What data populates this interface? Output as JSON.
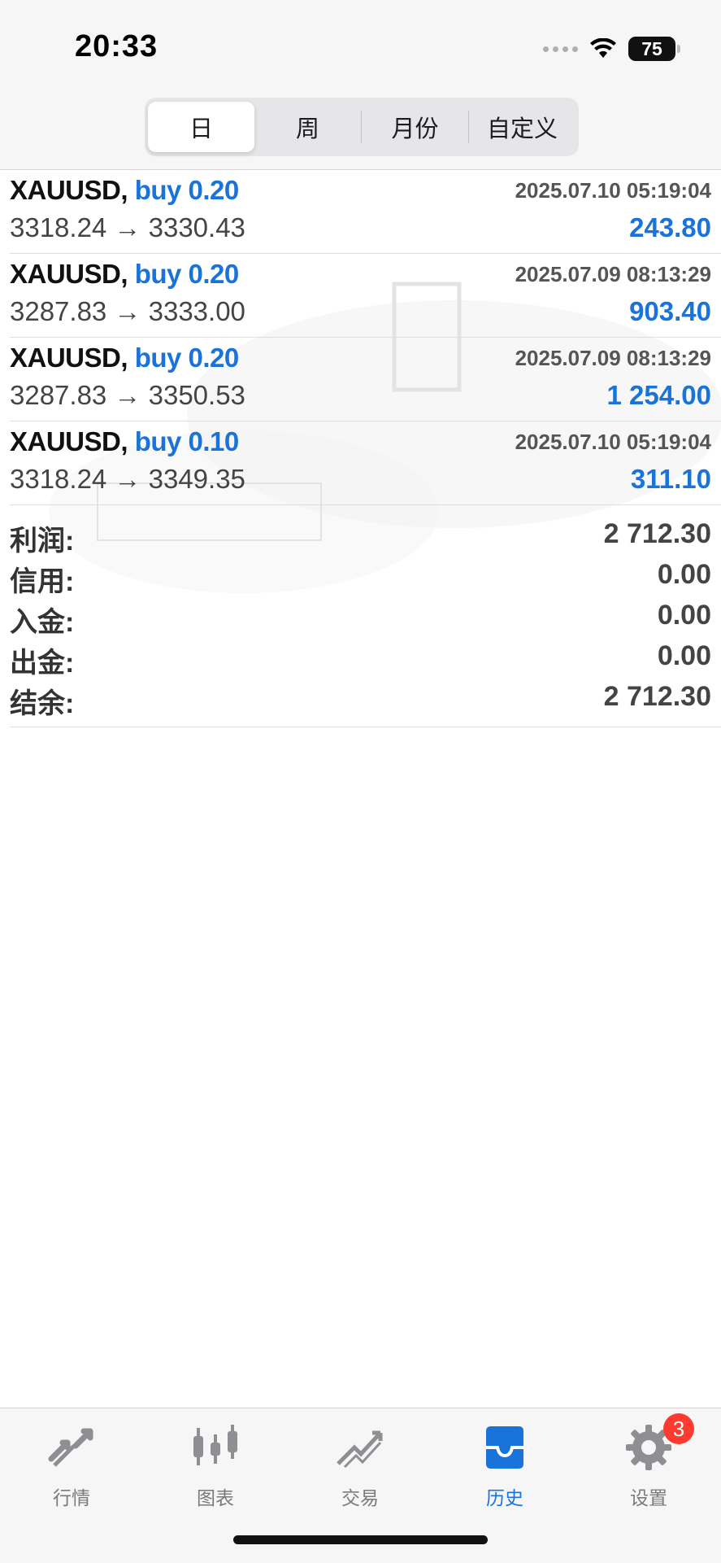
{
  "status": {
    "time": "20:33",
    "battery": "75"
  },
  "tabs_period": [
    {
      "label": "日",
      "active": true
    },
    {
      "label": "周",
      "active": false
    },
    {
      "label": "月份",
      "active": false
    },
    {
      "label": "自定义",
      "active": false
    }
  ],
  "trades": [
    {
      "symbol": "XAUUSD,",
      "direction": "buy 0.20",
      "datetime": "2025.07.10 05:19:04",
      "prices": "3318.24 → 3330.43",
      "profit": "243.80"
    },
    {
      "symbol": "XAUUSD,",
      "direction": "buy 0.20",
      "datetime": "2025.07.09 08:13:29",
      "prices": "3287.83 → 3333.00",
      "profit": "903.40"
    },
    {
      "symbol": "XAUUSD,",
      "direction": "buy 0.20",
      "datetime": "2025.07.09 08:13:29",
      "prices": "3287.83 → 3350.53",
      "profit": "1 254.00"
    },
    {
      "symbol": "XAUUSD,",
      "direction": "buy 0.10",
      "datetime": "2025.07.10 05:19:04",
      "prices": "3318.24 → 3349.35",
      "profit": "311.10"
    }
  ],
  "summary": [
    {
      "label": "利润:",
      "value": "2 712.30"
    },
    {
      "label": "信用:",
      "value": "0.00"
    },
    {
      "label": "入金:",
      "value": "0.00"
    },
    {
      "label": "出金:",
      "value": "0.00"
    },
    {
      "label": "结余:",
      "value": "2 712.30"
    }
  ],
  "bottom_tabs": [
    {
      "label": "行情",
      "icon": "quotes-icon"
    },
    {
      "label": "图表",
      "icon": "chart-icon"
    },
    {
      "label": "交易",
      "icon": "trade-icon"
    },
    {
      "label": "历史",
      "icon": "history-icon",
      "active": true
    },
    {
      "label": "设置",
      "icon": "settings-icon"
    }
  ],
  "settings_badge": "3",
  "watermark": {
    "text": "李槿"
  },
  "colors": {
    "accent": "#1a73d9",
    "badge": "#ff3b30"
  }
}
